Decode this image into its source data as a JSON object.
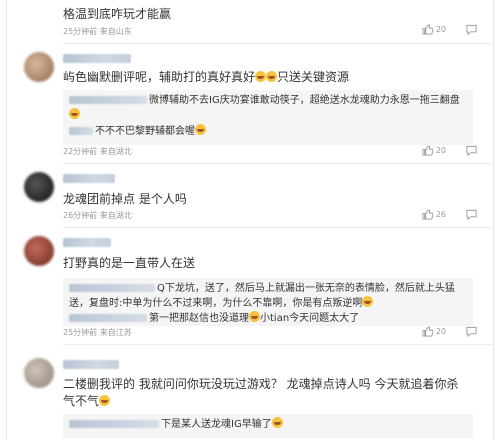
{
  "comments": [
    {
      "text": "格温到底咋玩才能赢",
      "meta": "25分钟前 来自山东",
      "likes": "20"
    },
    {
      "text_a": "屿色幽默删评呢，辅助打的真好真好",
      "text_b": "只送关键资源",
      "reply1_text": "微博辅助不去IG庆功宴谁敢动筷子，超绝送水龙魂助力永恩一拖三翻盘",
      "reply2_text": "不不不巴黎野辅都会喔",
      "meta": "22分钟前 来自湖北",
      "likes": "20"
    },
    {
      "text": "龙魂团前掉点 是个人吗",
      "meta": "26分钟前 来自湖北",
      "likes": "26"
    },
    {
      "text": "打野真的是一直带人在送",
      "reply1_text": "Q下龙坑，送了，然后马上就漏出一张无奈的表情脸，然后就上头猛送，复盘时:中单为什么不过来啊，为什么不靠啊，你是有点叛逆啊",
      "reply2_text_a": "第一把那赵信也没道理",
      "reply2_text_b": "小tian今天问题太大了",
      "meta": "25分钟前 来自江苏",
      "likes": "20"
    },
    {
      "text_a": "二楼删我评的 我就问问你玩没玩过游戏？ 龙魂掉点诗人吗 今天就追着你杀气不气",
      "reply1_text": "下是某人送龙魂IG早输了"
    }
  ],
  "colors": {
    "text": "#333333",
    "meta": "#9a9a9a",
    "reply_bg": "#f5f5f5",
    "divider": "#eeeeee"
  },
  "icons": [
    "thumbs-up-icon",
    "reply-icon",
    "emoji-icon"
  ]
}
